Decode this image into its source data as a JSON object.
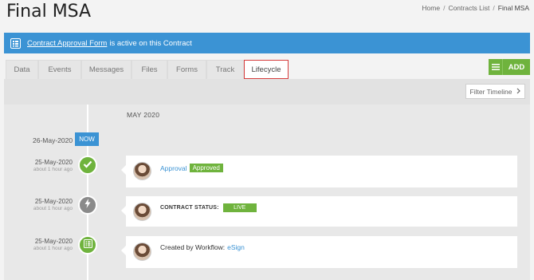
{
  "page": {
    "title": "Final MSA"
  },
  "breadcrumb": {
    "items": [
      "Home",
      "Contracts List",
      "Final MSA"
    ],
    "separator": "/"
  },
  "alert": {
    "link_text": "Contract Approval Form",
    "text": "is active on this Contract",
    "icon": "form-icon",
    "color": "#3b93d4"
  },
  "tabs": [
    {
      "label": "Data",
      "active": false
    },
    {
      "label": "Events",
      "active": false
    },
    {
      "label": "Messages",
      "active": false
    },
    {
      "label": "Files",
      "active": false
    },
    {
      "label": "Forms",
      "active": false
    },
    {
      "label": "Track",
      "active": false
    },
    {
      "label": "Lifecycle",
      "active": true
    }
  ],
  "add_button": {
    "label": "ADD",
    "icon": "hamburger-icon",
    "color": "#6fb33d"
  },
  "filter_button": {
    "label": "Filter Timeline",
    "icon": "chevron-right-icon"
  },
  "timeline": {
    "month": "MAY 2020",
    "now": {
      "date": "26-May-2020",
      "label": "NOW"
    },
    "events": [
      {
        "date": "25-May-2020",
        "ago": "about 1 hour ago",
        "icon": "check-icon",
        "color": "green",
        "link": "Approval",
        "badge": "Approved"
      },
      {
        "date": "25-May-2020",
        "ago": "about 1 hour ago",
        "icon": "lightning-icon",
        "color": "grey",
        "label": "CONTRACT STATUS:",
        "badge": "LIVE"
      },
      {
        "date": "25-May-2020",
        "ago": "about 1 hour ago",
        "icon": "form-icon",
        "color": "green",
        "text": "Created by Workflow:",
        "link": "eSign"
      }
    ]
  }
}
